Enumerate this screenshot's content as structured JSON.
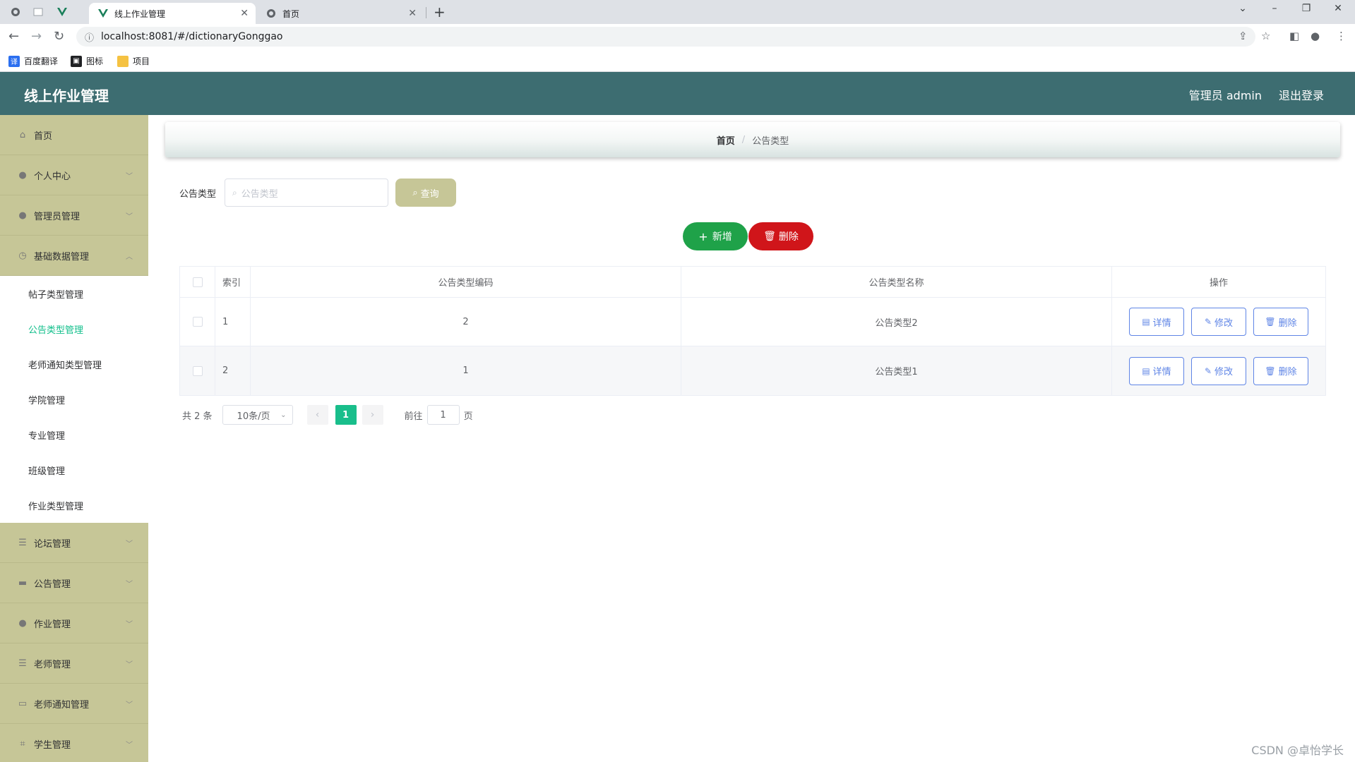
{
  "browser": {
    "tabs": [
      {
        "title": "线上作业管理",
        "active": true,
        "icon": "vue-logo-icon"
      },
      {
        "title": "首页",
        "active": false,
        "icon": "globe-icon"
      }
    ],
    "url": "localhost:8081/#/dictionaryGonggao",
    "bookmarks": [
      {
        "label": "百度翻译",
        "icon": "translate-icon",
        "color": "#2b6ff0"
      },
      {
        "label": "图标",
        "icon": "image-icon",
        "color": "#202124"
      },
      {
        "label": "项目",
        "icon": "folder-icon",
        "color": "#f5c242"
      }
    ]
  },
  "app": {
    "title": "线上作业管理",
    "user_label": "管理员 admin",
    "logout_label": "退出登录",
    "header_color": "#3d6d71",
    "sidebar_color": "#c6c697"
  },
  "sidebar": {
    "items": [
      {
        "label": "首页",
        "icon": "home-icon"
      },
      {
        "label": "个人中心",
        "icon": "user-icon"
      },
      {
        "label": "管理员管理",
        "icon": "user-icon"
      },
      {
        "label": "基础数据管理",
        "icon": "clock-icon"
      },
      {
        "label": "论坛管理",
        "icon": "list-icon"
      },
      {
        "label": "公告管理",
        "icon": "message-icon"
      },
      {
        "label": "作业管理",
        "icon": "user-icon"
      },
      {
        "label": "老师管理",
        "icon": "list-icon"
      },
      {
        "label": "老师通知管理",
        "icon": "chat-icon"
      },
      {
        "label": "学生管理",
        "icon": "crop-icon"
      }
    ],
    "submenu": [
      {
        "label": "帖子类型管理"
      },
      {
        "label": "公告类型管理",
        "active": true
      },
      {
        "label": "老师通知类型管理"
      },
      {
        "label": "学院管理"
      },
      {
        "label": "专业管理"
      },
      {
        "label": "班级管理"
      },
      {
        "label": "作业类型管理"
      }
    ]
  },
  "breadcrumb": {
    "home": "首页",
    "separator": "/",
    "current": "公告类型"
  },
  "search": {
    "label": "公告类型",
    "placeholder": "公告类型",
    "button": "查询"
  },
  "actions": {
    "add": "新增",
    "delete": "删除"
  },
  "table": {
    "headers": {
      "index": "索引",
      "code": "公告类型编码",
      "name": "公告类型名称",
      "ops": "操作"
    },
    "rows": [
      {
        "index": "1",
        "code": "2",
        "name": "公告类型2"
      },
      {
        "index": "2",
        "code": "1",
        "name": "公告类型1"
      }
    ],
    "row_actions": {
      "detail": "详情",
      "edit": "修改",
      "delete": "删除"
    }
  },
  "pagination": {
    "total": "共 2 条",
    "page_size": "10条/页",
    "current_page": "1",
    "goto_prefix": "前往",
    "goto_value": "1",
    "goto_suffix": "页"
  },
  "watermark": "CSDN @卓怡学长"
}
